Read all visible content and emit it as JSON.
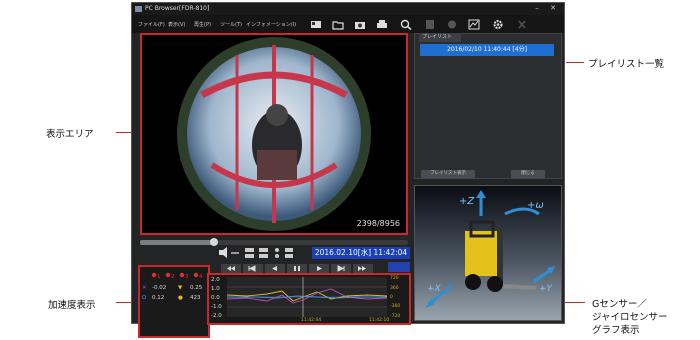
{
  "window": {
    "title": "PC Browser[FDR-810]"
  },
  "menu": [
    "ファイル(F)",
    "表示(V)",
    "再生(P)",
    "ツール(T)",
    "インフォメーション(I)"
  ],
  "video": {
    "frame_counter": "2398/8956"
  },
  "playback": {
    "datetime": "2016.02.10[水] 11:42:04"
  },
  "playlist": {
    "tab_label": "プレイリスト",
    "items": [
      "2016/02/10 11:40:44 [4分]"
    ],
    "btn_left": "プレイリスト表示",
    "btn_right": "閉じる"
  },
  "accel": {
    "channels": [
      "1",
      "2",
      "3",
      "4"
    ],
    "row1": {
      "a": "-0.02",
      "b": "0.25"
    },
    "row2": {
      "a": "0.12",
      "b": "423"
    }
  },
  "graph": {
    "yticks": [
      "2.0",
      "1.0",
      "0.0",
      "-1.0",
      "-2.0"
    ],
    "right_ticks": [
      "720",
      "360",
      "0",
      "-360",
      "-720"
    ],
    "time_left": "11:42:04",
    "time_right": "11:42:10"
  },
  "cube": {
    "z": "+Z",
    "omega": "+ω",
    "x": "+X",
    "y": "+Y"
  },
  "annotations": {
    "display_area": "表示エリア",
    "accel_display": "加速度表示",
    "playlist_list": "プレイリスト一覧",
    "sensor_line1": "Gセンサー／",
    "sensor_line2": "ジャイロセンサー",
    "sensor_line3": "グラフ表示"
  },
  "colors": {
    "accent": "#c82a2a",
    "highlight": "#1e6fd1",
    "date_bg": "#1b3fb5"
  }
}
